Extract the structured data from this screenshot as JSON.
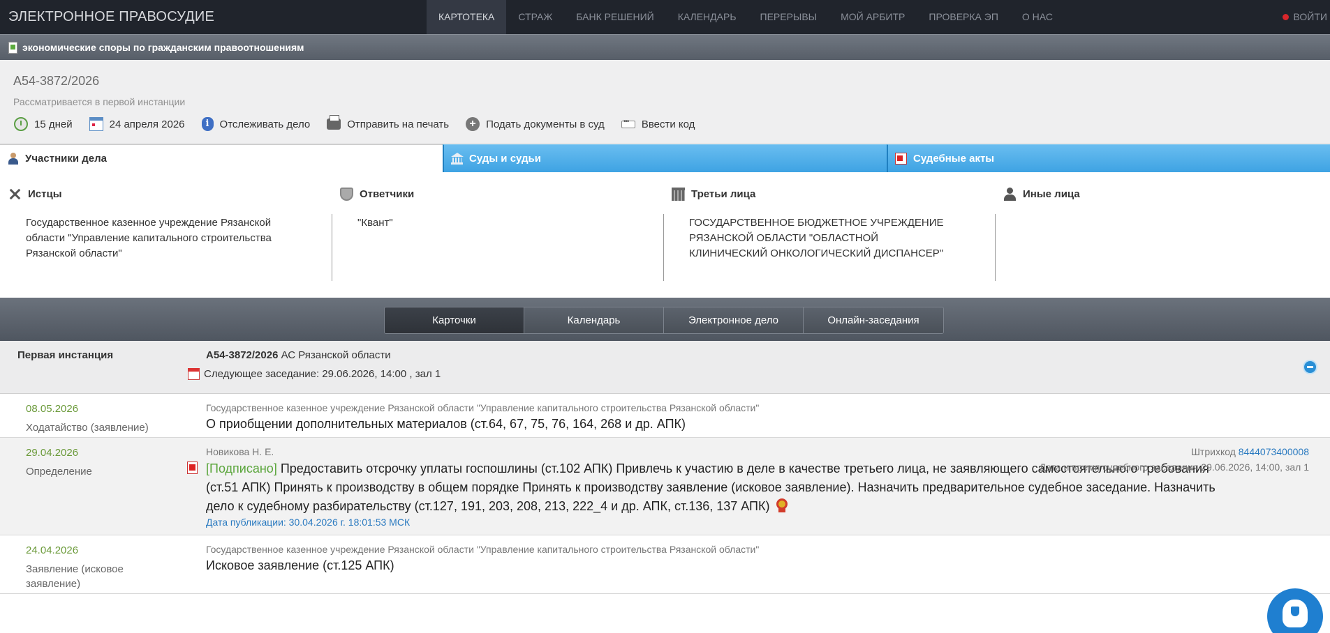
{
  "header": {
    "brand": "ЭЛЕКТРОННОЕ ПРАВОСУДИЕ",
    "nav": [
      {
        "label": "КАРТОТЕКА",
        "active": true
      },
      {
        "label": "СТРАЖ"
      },
      {
        "label": "БАНК РЕШЕНИЙ"
      },
      {
        "label": "КАЛЕНДАРЬ"
      },
      {
        "label": "ПЕРЕРЫВЫ"
      },
      {
        "label": "МОЙ АРБИТР"
      },
      {
        "label": "ПРОВЕРКА ЭП"
      },
      {
        "label": "О НАС"
      }
    ],
    "login_label": "ВОЙТИ"
  },
  "category": "экономические споры по гражданским правоотношениям",
  "case": {
    "number": "А54-3872/2026",
    "status": "Рассматривается в первой инстанции",
    "actions": {
      "days": "15 дней",
      "date": "24 апреля 2026",
      "track": "Отслеживать дело",
      "print": "Отправить на печать",
      "submit": "Подать документы в суд",
      "code": "Ввести код"
    }
  },
  "tabs": {
    "participants": "Участники дела",
    "courts": "Суды и судьи",
    "acts": "Судебные акты"
  },
  "participants": {
    "plaintiffs": {
      "title": "Истцы",
      "body": "Государственное казенное учреждение Рязанской области \"Управление капитального строительства Рязанской области\""
    },
    "defendants": {
      "title": "Ответчики",
      "body": "\"Квант\""
    },
    "third": {
      "title": "Третьи лица",
      "body": "ГОСУДАРСТВЕННОЕ БЮДЖЕТНОЕ УЧРЕЖДЕНИЕ РЯЗАНСКОЙ ОБЛАСТИ \"ОБЛАСТНОЙ КЛИНИЧЕСКИЙ ОНКОЛОГИЧЕСКИЙ ДИСПАНСЕР\""
    },
    "other": {
      "title": "Иные лица",
      "body": ""
    }
  },
  "subtabs": [
    "Карточки",
    "Календарь",
    "Электронное дело",
    "Онлайн-заседания"
  ],
  "instance": {
    "label": "Первая инстанция",
    "case_number": "А54-3872/2026",
    "court": "АС Рязанской области",
    "next_hearing": "Следующее заседание: 29.06.2026, 14:00 , зал 1"
  },
  "documents": [
    {
      "date": "08.05.2026",
      "type": "Ходатайство (заявление)",
      "author": "Государственное казенное учреждение Рязанской области \"Управление капитального строительства Рязанской области\"",
      "title": "О приобщении дополнительных материалов (ст.64, 67, 75, 76, 164, 268 и др. АПК)"
    },
    {
      "date": "29.04.2026",
      "type": "Определение",
      "author": "Новикова Н. Е.",
      "signed": "[Подписано]",
      "title": "Предоставить отсрочку уплаты госпошлины (ст.102 АПК) Привлечь к участию в деле в качестве третьего лица, не заявляющего самостоятельного требования (ст.51 АПК) Принять к производству в общем порядке Принять к производству заявление (исковое заявление). Назначить предварительное судебное заседание. Назначить дело к судебному разбирательству (ст.127, 191, 203, 208, 213, 222_4 и др. АПК, ст.136, 137 АПК)",
      "publication": "Дата публикации: 30.04.2026 г. 18:01:53 МСК",
      "barcode_label": "Штрихкод",
      "barcode": "8444073400008",
      "hearing": "Дата и время судебного заседания 29.06.2026, 14:00, зал 1"
    },
    {
      "date": "24.04.2026",
      "type": "Заявление (исковое заявление)",
      "author": "Государственное казенное учреждение Рязанской области \"Управление капитального строительства Рязанской области\"",
      "title": "Исковое заявление (ст.125 АПК)"
    }
  ]
}
